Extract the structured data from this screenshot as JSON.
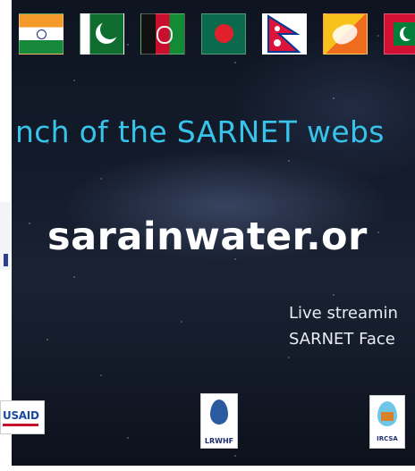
{
  "flags": [
    {
      "country": "India",
      "icon": "india-flag-icon"
    },
    {
      "country": "Pakistan",
      "icon": "pakistan-flag-icon"
    },
    {
      "country": "Afghanistan",
      "icon": "afghanistan-flag-icon"
    },
    {
      "country": "Bangladesh",
      "icon": "bangladesh-flag-icon"
    },
    {
      "country": "Nepal",
      "icon": "nepal-flag-icon"
    },
    {
      "country": "Bhutan",
      "icon": "bhutan-flag-icon"
    },
    {
      "country": "Maldives",
      "icon": "maldives-flag-icon"
    }
  ],
  "headline": "nch of the SARNET webs",
  "website": "sarainwater.or",
  "live": {
    "line1": "Live  streamin",
    "line2": "SARNET Face"
  },
  "logos": {
    "usaid": "USAID",
    "lrwhf": "LRWHF",
    "ircsa": "IRCSA"
  },
  "colors": {
    "headline": "#37c3ea",
    "website": "#ffffff",
    "background": "#141c2c"
  }
}
